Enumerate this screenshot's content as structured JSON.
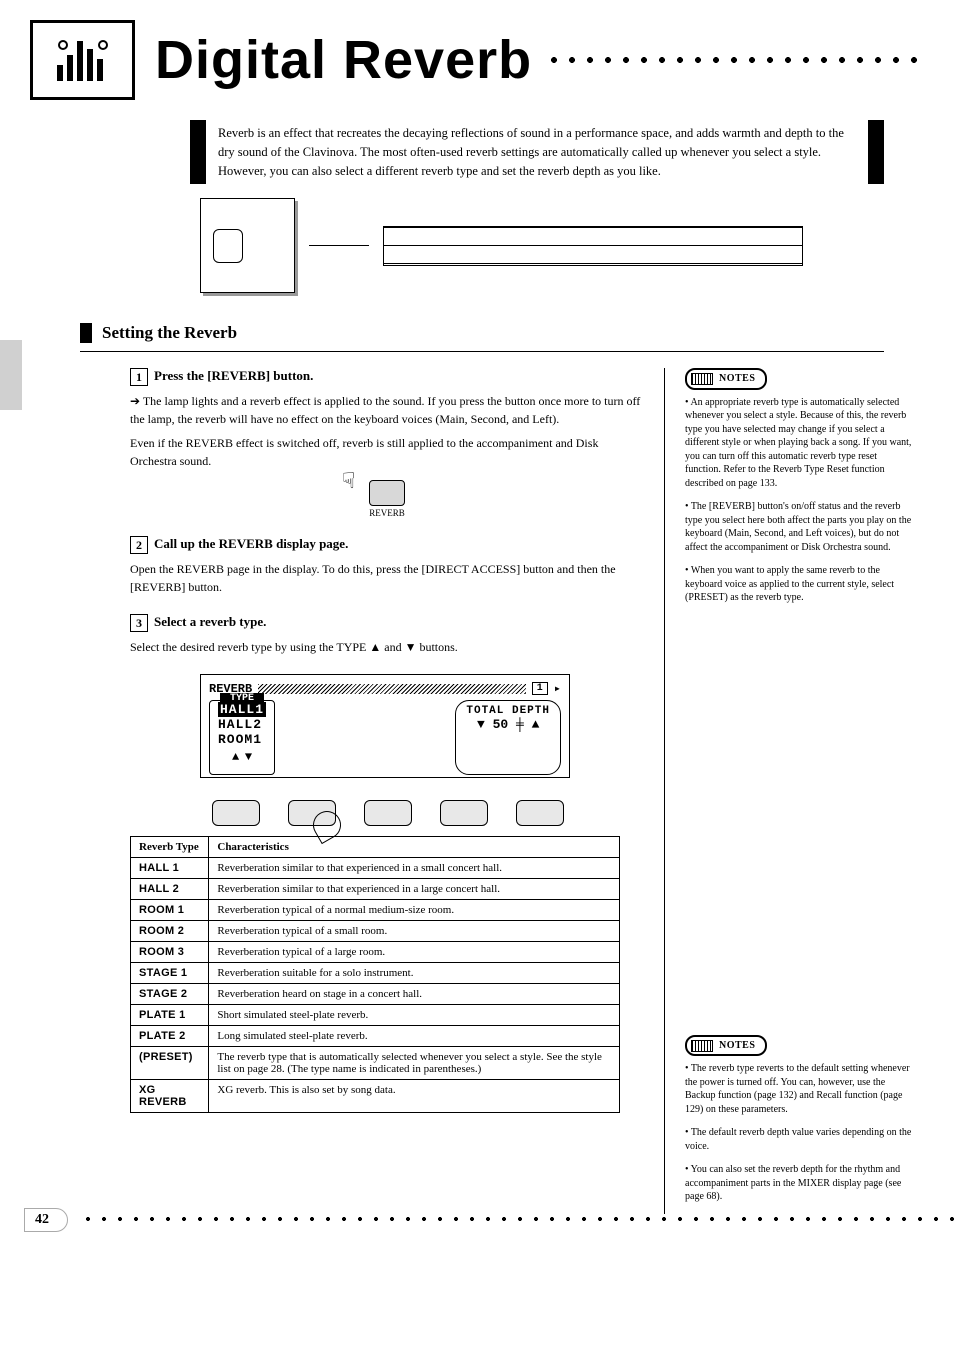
{
  "header": {
    "title": "Digital Reverb"
  },
  "intro": "Reverb is an effect that recreates the decaying reflections of sound in a performance space, and adds warmth and depth to the dry sound of the Clavinova. The most often-used reverb settings are automatically called up whenever you select a style. However, you can also select a different reverb type and set the reverb depth as you like.",
  "section_title": "Setting the Reverb",
  "steps": {
    "s1": {
      "title": "Press the [REVERB] button.",
      "rev_button_label": "REVERB",
      "note": "➔ The lamp lights and a reverb effect is applied to the sound. If you press the button once more to turn off the lamp, the reverb will have no effect on the keyboard voices (Main, Second, and Left).",
      "note2": "Even if the REVERB effect is switched off, reverb is still applied to the accompaniment and Disk Orchestra sound."
    },
    "s2": {
      "title": "Call up the REVERB display page.",
      "body": "Open the REVERB page in the display. To do this, press the [DIRECT ACCESS] button and then the [REVERB] button."
    },
    "s3": {
      "title": "Select a reverb type.",
      "body": "Select the desired reverb type by using the TYPE ▲ and ▼ buttons."
    }
  },
  "lcd": {
    "title": "REVERB",
    "page_no": "1",
    "type_label": "TYPE",
    "type_items": [
      "HALL1",
      "HALL2",
      "ROOM1"
    ],
    "type_selected": "HALL1",
    "depth_label": "TOTAL DEPTH",
    "depth_value": "50"
  },
  "reverb_types_header": {
    "type": "Reverb Type",
    "char": "Characteristics"
  },
  "reverb_types": [
    {
      "type": "HALL 1",
      "char": "Reverberation similar to that experienced in a small concert hall."
    },
    {
      "type": "HALL 2",
      "char": "Reverberation similar to that experienced in a large concert hall."
    },
    {
      "type": "ROOM 1",
      "char": "Reverberation typical of a normal medium-size room."
    },
    {
      "type": "ROOM 2",
      "char": "Reverberation typical of a small room."
    },
    {
      "type": "ROOM 3",
      "char": "Reverberation typical of a large room."
    },
    {
      "type": "STAGE 1",
      "char": "Reverberation suitable for a solo instrument."
    },
    {
      "type": "STAGE 2",
      "char": "Reverberation heard on stage in a concert hall."
    },
    {
      "type": "PLATE 1",
      "char": "Short simulated steel-plate reverb."
    },
    {
      "type": "PLATE 2",
      "char": "Long simulated steel-plate reverb."
    },
    {
      "type": "(PRESET)",
      "char": "The reverb type that is automatically selected whenever you select a style. See the style list on page 28. (The type name is indicated in parentheses.)"
    },
    {
      "type": "XG REVERB",
      "char": "XG reverb. This is also set by song data."
    }
  ],
  "notes_label": "NOTES",
  "side_notes_1": [
    "An appropriate reverb type is automatically selected whenever you select a style. Because of this, the reverb type you have selected may change if you select a different style or when playing back a song. If you want, you can turn off this automatic reverb type reset function. Refer to the Reverb Type Reset function described on page 133.",
    "The [REVERB] button's on/off status and the reverb type you select here both affect the parts you play on the keyboard (Main, Second, and Left voices), but do not affect the accompaniment or Disk Orchestra sound.",
    "When you want to apply the same reverb to the keyboard voice as applied to the current style, select (PRESET) as the reverb type."
  ],
  "side_notes_2": [
    "The reverb type reverts to the default setting whenever the power is turned off. You can, however, use the Backup function (page 132) and Recall function (page 129) on these parameters.",
    "The default reverb depth value varies depending on the voice.",
    "You can also set the reverb depth for the rhythm and accompaniment parts in the MIXER display page (see page 68)."
  ],
  "page_number": "42"
}
